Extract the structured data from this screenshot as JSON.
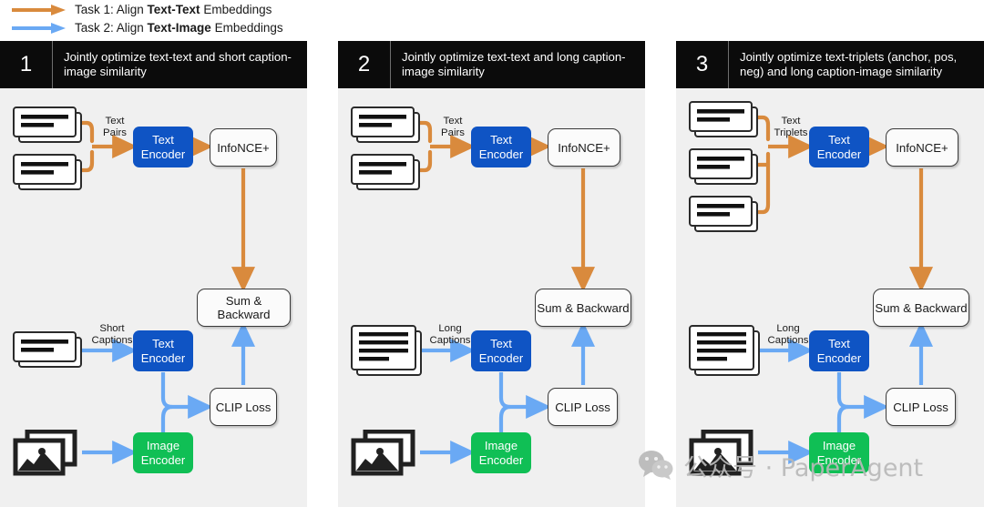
{
  "legend": {
    "items": [
      {
        "id": "task1",
        "color": "#d98a3d",
        "prefix": "Task 1: Align ",
        "strong": "Text-Text",
        "suffix": " Embeddings"
      },
      {
        "id": "task2",
        "color": "#6aa9f4",
        "prefix": "Task 2: Align ",
        "strong": "Text-Image",
        "suffix": " Embeddings"
      }
    ]
  },
  "colors": {
    "orange": "#d98a3d",
    "blue_arrow": "#6aa9f4",
    "text_encoder": "#0f54c4",
    "image_encoder": "#10bf55",
    "panel_bg": "#f0f0f0",
    "header_bg": "#0b0b0b",
    "box_border": "#3a3a3a"
  },
  "panels": [
    {
      "number": "1",
      "title": "Jointly optimize text-text and short caption-image similarity",
      "top": {
        "doc_count": 2,
        "doc_lines": 2,
        "edge_label": "Text Pairs",
        "encoder": "Text Encoder",
        "loss": "InfoNCE+"
      },
      "bottom": {
        "doc_count": 1,
        "doc_lines": 2,
        "edge_label": "Short Captions",
        "text_encoder": "Text Encoder",
        "image_encoder": "Image Encoder",
        "loss": "CLIP Loss"
      },
      "sum": "Sum & Backward"
    },
    {
      "number": "2",
      "title": "Jointly optimize text-text and long caption-image similarity",
      "top": {
        "doc_count": 2,
        "doc_lines": 2,
        "edge_label": "Text Pairs",
        "encoder": "Text Encoder",
        "loss": "InfoNCE+"
      },
      "bottom": {
        "doc_count": 1,
        "doc_lines": 4,
        "edge_label": "Long Captions",
        "text_encoder": "Text Encoder",
        "image_encoder": "Image Encoder",
        "loss": "CLIP Loss"
      },
      "sum": "Sum & Backward"
    },
    {
      "number": "3",
      "title": "Jointly optimize text-triplets (anchor, pos, neg) and long caption-image similarity",
      "top": {
        "doc_count": 3,
        "doc_lines": 2,
        "edge_label": "Text Triplets",
        "encoder": "Text Encoder",
        "loss": "InfoNCE+"
      },
      "bottom": {
        "doc_count": 1,
        "doc_lines": 4,
        "edge_label": "Long Captions",
        "text_encoder": "Text Encoder",
        "image_encoder": "Image Encoder",
        "loss": "CLIP Loss"
      },
      "sum": "Sum & Backward"
    }
  ],
  "watermark": {
    "text": "公众号 · PaperAgent",
    "icon": "wechat-logo"
  }
}
